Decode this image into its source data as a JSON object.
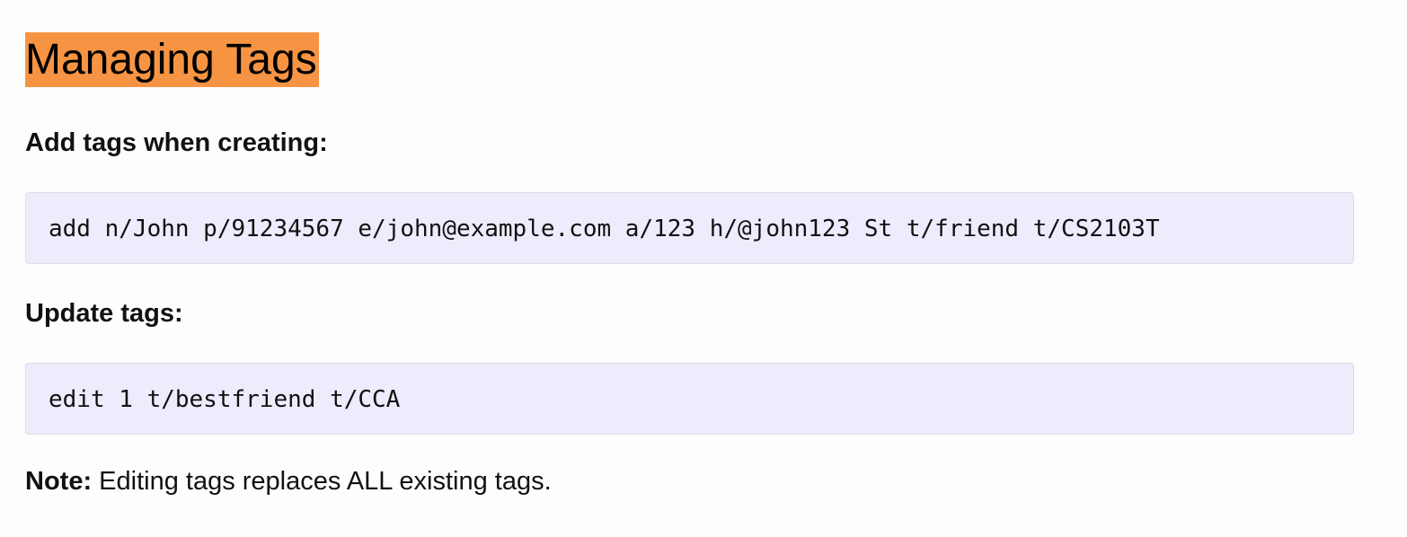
{
  "colors": {
    "title_highlight": "#f79443",
    "code_background": "#ececfd",
    "text": "#111111"
  },
  "title": "Managing Tags",
  "sections": [
    {
      "heading": "Add tags when creating:",
      "code": "add n/John p/91234567 e/john@example.com a/123 h/@john123 St t/friend t/CS2103T"
    },
    {
      "heading": "Update tags:",
      "code": "edit 1 t/bestfriend t/CCA"
    }
  ],
  "note": {
    "label": "Note:",
    "text": " Editing tags replaces ALL existing tags."
  }
}
